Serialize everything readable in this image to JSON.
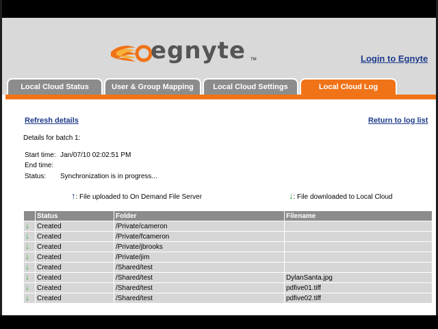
{
  "header": {
    "logo_text": "egnyte",
    "logo_tm": "TM",
    "login_link": "Login to Egnyte"
  },
  "tabs": [
    {
      "label": "Local Cloud Status",
      "active": false
    },
    {
      "label": "User & Group Mapping",
      "active": false
    },
    {
      "label": "Local Cloud Settings",
      "active": false
    },
    {
      "label": "Local Cloud Log",
      "active": true
    }
  ],
  "main": {
    "refresh_link": "Refresh details",
    "return_link": "Return to log list",
    "batch_title": "Details for batch 1:",
    "start_time_label": "Start time:",
    "start_time_value": "Jan/07/10 02:02:51 PM",
    "end_time_label": "End time:",
    "end_time_value": "",
    "status_label": "Status:",
    "status_value": "Synchronization is in progress...",
    "legend_upload": ": File uploaded to On Demand File Server",
    "legend_download": ": File downloaded to Local Cloud"
  },
  "table": {
    "headers": [
      "",
      "Status",
      "Folder",
      "Filename"
    ],
    "rows": [
      {
        "direction": "down",
        "status": "Created",
        "folder": "/Private/cameron",
        "filename": ""
      },
      {
        "direction": "down",
        "status": "Created",
        "folder": "/Private/fcameron",
        "filename": ""
      },
      {
        "direction": "down",
        "status": "Created",
        "folder": "/Private/jbrooks",
        "filename": ""
      },
      {
        "direction": "down",
        "status": "Created",
        "folder": "/Private/jim",
        "filename": ""
      },
      {
        "direction": "down",
        "status": "Created",
        "folder": "/Shared/test",
        "filename": ""
      },
      {
        "direction": "down",
        "status": "Created",
        "folder": "/Shared/test",
        "filename": "DylanSanta.jpg"
      },
      {
        "direction": "down",
        "status": "Created",
        "folder": "/Shared/test",
        "filename": "pdfive01.tiff"
      },
      {
        "direction": "down",
        "status": "Created",
        "folder": "/Shared/test",
        "filename": "pdfive02.tiff"
      }
    ]
  },
  "colors": {
    "accent": "#f07318",
    "tab_inactive": "#8c8c8c",
    "link": "#1c3a8a",
    "download_arrow": "#2aa532",
    "upload_arrow": "#1c2f7a"
  },
  "icons": {
    "upload": "arrow-up-icon",
    "download": "arrow-down-icon"
  }
}
